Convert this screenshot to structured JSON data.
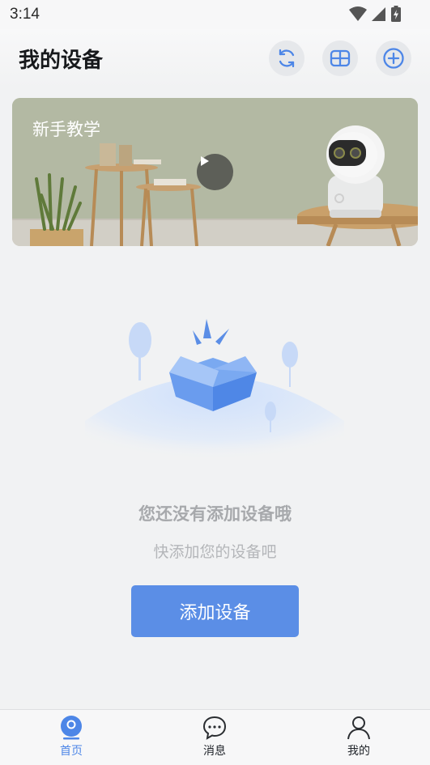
{
  "status": {
    "time": "3:14"
  },
  "header": {
    "title": "我的设备"
  },
  "banner": {
    "title": "新手教学"
  },
  "empty": {
    "title": "您还没有添加设备哦",
    "subtitle": "快添加您的设备吧"
  },
  "add_button": {
    "label": "添加设备"
  },
  "tabs": [
    {
      "label": "首页",
      "icon": "home-camera-icon",
      "active": true
    },
    {
      "label": "消息",
      "icon": "message-icon",
      "active": false
    },
    {
      "label": "我的",
      "icon": "profile-icon",
      "active": false
    }
  ],
  "colors": {
    "accent": "#5b8ee6",
    "active_tab": "#4d86e7"
  }
}
